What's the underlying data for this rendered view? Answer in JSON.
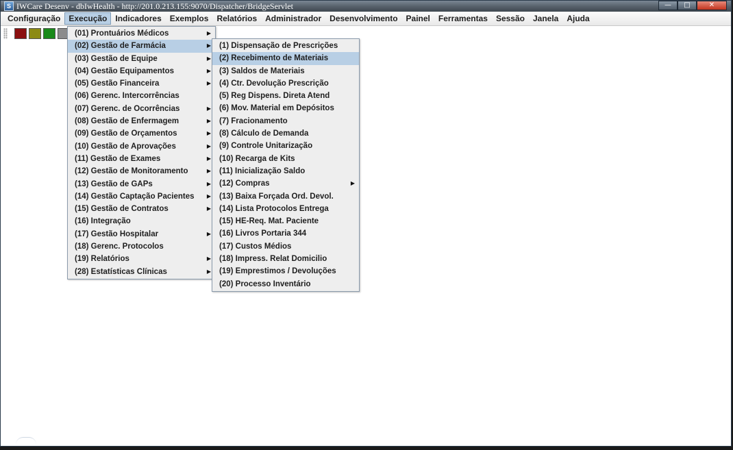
{
  "window": {
    "title": "IWCare Desenv - dbIwHealth - http://201.0.213.155:9070/Dispatcher/BridgeServlet",
    "minimize": "—",
    "maximize": "□",
    "close": "✕"
  },
  "menubar": [
    {
      "label": "Configuração"
    },
    {
      "label": "Execução",
      "active": true
    },
    {
      "label": "Indicadores"
    },
    {
      "label": "Exemplos"
    },
    {
      "label": "Relatórios"
    },
    {
      "label": "Administrador"
    },
    {
      "label": "Desenvolvimento"
    },
    {
      "label": "Painel"
    },
    {
      "label": "Ferramentas"
    },
    {
      "label": "Sessão"
    },
    {
      "label": "Janela"
    },
    {
      "label": "Ajuda"
    }
  ],
  "toolbar": {
    "buttons": [
      {
        "icon": "red-square-icon",
        "color": "#8b1010"
      },
      {
        "icon": "olive-square-icon",
        "color": "#8c8a14"
      },
      {
        "icon": "green-square-icon",
        "color": "#1a8a1a"
      },
      {
        "icon": "gray-square-icon",
        "color": "#8c8c8c"
      }
    ]
  },
  "execucao_menu": [
    {
      "label": "(01) Prontuários Médicos",
      "submenu": true
    },
    {
      "label": "(02) Gestão de Farmácia",
      "submenu": true,
      "active": true
    },
    {
      "label": "(03) Gestão de Equipe",
      "submenu": true
    },
    {
      "label": "(04) Gestão Equipamentos",
      "submenu": true
    },
    {
      "label": "(05) Gestão Financeira",
      "submenu": true
    },
    {
      "label": "(06) Gerenc. Intercorrências",
      "submenu": false
    },
    {
      "label": "(07) Gerenc. de Ocorrências",
      "submenu": true
    },
    {
      "label": "(08) Gestão de Enfermagem",
      "submenu": true
    },
    {
      "label": "(09) Gestão de Orçamentos",
      "submenu": true
    },
    {
      "label": "(10) Gestão de Aprovações",
      "submenu": true
    },
    {
      "label": "(11) Gestão de Exames",
      "submenu": true
    },
    {
      "label": "(12) Gestão de Monitoramento",
      "submenu": true
    },
    {
      "label": "(13) Gestão de GAPs",
      "submenu": true
    },
    {
      "label": "(14) Gestão Captação Pacientes",
      "submenu": true
    },
    {
      "label": "(15) Gestão de Contratos",
      "submenu": true
    },
    {
      "label": "(16) Integração",
      "submenu": false
    },
    {
      "label": "(17) Gestão Hospitalar",
      "submenu": true
    },
    {
      "label": "(18) Gerenc. Protocolos",
      "submenu": false
    },
    {
      "label": "(19) Relatórios",
      "submenu": true
    },
    {
      "label": "(28) Estatísticas Clínicas",
      "submenu": true
    }
  ],
  "farmacia_menu": [
    {
      "label": "(1) Dispensação de Prescrições",
      "submenu": false
    },
    {
      "label": "(2) Recebimento de Materiais",
      "submenu": false,
      "active": true
    },
    {
      "label": "(3) Saldos de Materiais",
      "submenu": false
    },
    {
      "label": "(4) Ctr. Devolução Prescrição",
      "submenu": false
    },
    {
      "label": "(5) Reg Dispens. Direta Atend",
      "submenu": false
    },
    {
      "label": "(6) Mov. Material em Depósitos",
      "submenu": false
    },
    {
      "label": "(7) Fracionamento",
      "submenu": false
    },
    {
      "label": "(8) Cálculo de Demanda",
      "submenu": false
    },
    {
      "label": "(9) Controle Unitarização",
      "submenu": false
    },
    {
      "label": "(10) Recarga de Kits",
      "submenu": false
    },
    {
      "label": "(11) Inicialização Saldo",
      "submenu": false
    },
    {
      "label": "(12) Compras",
      "submenu": true
    },
    {
      "label": "(13) Baixa Forçada Ord. Devol.",
      "submenu": false
    },
    {
      "label": "(14) Lista Protocolos Entrega",
      "submenu": false
    },
    {
      "label": "(15) HE-Req. Mat. Paciente",
      "submenu": false
    },
    {
      "label": "(16) Livros Portaria 344",
      "submenu": false
    },
    {
      "label": "(17) Custos Médios",
      "submenu": false
    },
    {
      "label": "(18) Impress. Relat Domicilio",
      "submenu": false
    },
    {
      "label": "(19) Emprestimos / Devoluções",
      "submenu": false
    },
    {
      "label": "(20) Processo Inventário",
      "submenu": false
    }
  ],
  "arrow_glyph": "▶",
  "colors": {
    "highlight": "#b8cfe5",
    "menu_bg": "#eeeeee"
  }
}
